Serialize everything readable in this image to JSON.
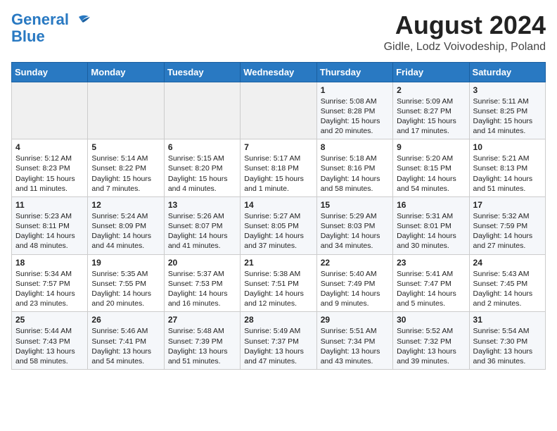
{
  "header": {
    "logo_line1": "General",
    "logo_line2": "Blue",
    "title": "August 2024",
    "subtitle": "Gidle, Lodz Voivodeship, Poland"
  },
  "weekdays": [
    "Sunday",
    "Monday",
    "Tuesday",
    "Wednesday",
    "Thursday",
    "Friday",
    "Saturday"
  ],
  "weeks": [
    [
      {
        "day": "",
        "info": ""
      },
      {
        "day": "",
        "info": ""
      },
      {
        "day": "",
        "info": ""
      },
      {
        "day": "",
        "info": ""
      },
      {
        "day": "1",
        "info": "Sunrise: 5:08 AM\nSunset: 8:28 PM\nDaylight: 15 hours\nand 20 minutes."
      },
      {
        "day": "2",
        "info": "Sunrise: 5:09 AM\nSunset: 8:27 PM\nDaylight: 15 hours\nand 17 minutes."
      },
      {
        "day": "3",
        "info": "Sunrise: 5:11 AM\nSunset: 8:25 PM\nDaylight: 15 hours\nand 14 minutes."
      }
    ],
    [
      {
        "day": "4",
        "info": "Sunrise: 5:12 AM\nSunset: 8:23 PM\nDaylight: 15 hours\nand 11 minutes."
      },
      {
        "day": "5",
        "info": "Sunrise: 5:14 AM\nSunset: 8:22 PM\nDaylight: 15 hours\nand 7 minutes."
      },
      {
        "day": "6",
        "info": "Sunrise: 5:15 AM\nSunset: 8:20 PM\nDaylight: 15 hours\nand 4 minutes."
      },
      {
        "day": "7",
        "info": "Sunrise: 5:17 AM\nSunset: 8:18 PM\nDaylight: 15 hours\nand 1 minute."
      },
      {
        "day": "8",
        "info": "Sunrise: 5:18 AM\nSunset: 8:16 PM\nDaylight: 14 hours\nand 58 minutes."
      },
      {
        "day": "9",
        "info": "Sunrise: 5:20 AM\nSunset: 8:15 PM\nDaylight: 14 hours\nand 54 minutes."
      },
      {
        "day": "10",
        "info": "Sunrise: 5:21 AM\nSunset: 8:13 PM\nDaylight: 14 hours\nand 51 minutes."
      }
    ],
    [
      {
        "day": "11",
        "info": "Sunrise: 5:23 AM\nSunset: 8:11 PM\nDaylight: 14 hours\nand 48 minutes."
      },
      {
        "day": "12",
        "info": "Sunrise: 5:24 AM\nSunset: 8:09 PM\nDaylight: 14 hours\nand 44 minutes."
      },
      {
        "day": "13",
        "info": "Sunrise: 5:26 AM\nSunset: 8:07 PM\nDaylight: 14 hours\nand 41 minutes."
      },
      {
        "day": "14",
        "info": "Sunrise: 5:27 AM\nSunset: 8:05 PM\nDaylight: 14 hours\nand 37 minutes."
      },
      {
        "day": "15",
        "info": "Sunrise: 5:29 AM\nSunset: 8:03 PM\nDaylight: 14 hours\nand 34 minutes."
      },
      {
        "day": "16",
        "info": "Sunrise: 5:31 AM\nSunset: 8:01 PM\nDaylight: 14 hours\nand 30 minutes."
      },
      {
        "day": "17",
        "info": "Sunrise: 5:32 AM\nSunset: 7:59 PM\nDaylight: 14 hours\nand 27 minutes."
      }
    ],
    [
      {
        "day": "18",
        "info": "Sunrise: 5:34 AM\nSunset: 7:57 PM\nDaylight: 14 hours\nand 23 minutes."
      },
      {
        "day": "19",
        "info": "Sunrise: 5:35 AM\nSunset: 7:55 PM\nDaylight: 14 hours\nand 20 minutes."
      },
      {
        "day": "20",
        "info": "Sunrise: 5:37 AM\nSunset: 7:53 PM\nDaylight: 14 hours\nand 16 minutes."
      },
      {
        "day": "21",
        "info": "Sunrise: 5:38 AM\nSunset: 7:51 PM\nDaylight: 14 hours\nand 12 minutes."
      },
      {
        "day": "22",
        "info": "Sunrise: 5:40 AM\nSunset: 7:49 PM\nDaylight: 14 hours\nand 9 minutes."
      },
      {
        "day": "23",
        "info": "Sunrise: 5:41 AM\nSunset: 7:47 PM\nDaylight: 14 hours\nand 5 minutes."
      },
      {
        "day": "24",
        "info": "Sunrise: 5:43 AM\nSunset: 7:45 PM\nDaylight: 14 hours\nand 2 minutes."
      }
    ],
    [
      {
        "day": "25",
        "info": "Sunrise: 5:44 AM\nSunset: 7:43 PM\nDaylight: 13 hours\nand 58 minutes."
      },
      {
        "day": "26",
        "info": "Sunrise: 5:46 AM\nSunset: 7:41 PM\nDaylight: 13 hours\nand 54 minutes."
      },
      {
        "day": "27",
        "info": "Sunrise: 5:48 AM\nSunset: 7:39 PM\nDaylight: 13 hours\nand 51 minutes."
      },
      {
        "day": "28",
        "info": "Sunrise: 5:49 AM\nSunset: 7:37 PM\nDaylight: 13 hours\nand 47 minutes."
      },
      {
        "day": "29",
        "info": "Sunrise: 5:51 AM\nSunset: 7:34 PM\nDaylight: 13 hours\nand 43 minutes."
      },
      {
        "day": "30",
        "info": "Sunrise: 5:52 AM\nSunset: 7:32 PM\nDaylight: 13 hours\nand 39 minutes."
      },
      {
        "day": "31",
        "info": "Sunrise: 5:54 AM\nSunset: 7:30 PM\nDaylight: 13 hours\nand 36 minutes."
      }
    ]
  ]
}
